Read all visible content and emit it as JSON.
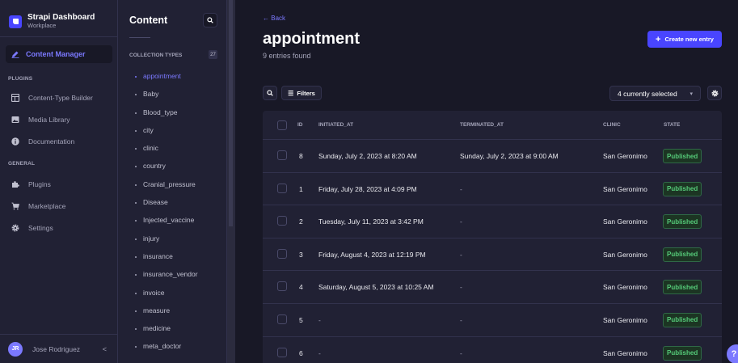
{
  "app": {
    "brand_title": "Strapi Dashboard",
    "brand_subtitle": "Workplace"
  },
  "mainnav": {
    "active_item": "Content Manager",
    "plugins_heading": "PLUGINS",
    "plugins": [
      "Content-Type Builder",
      "Media Library",
      "Documentation"
    ],
    "general_heading": "GENERAL",
    "general": [
      "Plugins",
      "Marketplace",
      "Settings"
    ],
    "user_initials": "JR",
    "user_name": "Jose Rodriguez",
    "collapse_glyph": "<"
  },
  "subnav": {
    "title": "Content",
    "collection_heading": "COLLECTION TYPES",
    "collection_count": "27",
    "items": [
      "appointment",
      "Baby",
      "Blood_type",
      "city",
      "clinic",
      "country",
      "Cranial_pressure",
      "Disease",
      "Injected_vaccine",
      "injury",
      "insurance",
      "insurance_vendor",
      "invoice",
      "measure",
      "medicine",
      "meta_doctor"
    ],
    "active_index": 0
  },
  "main": {
    "back_label": "Back",
    "title": "appointment",
    "subtitle": "9 entries found",
    "create_label": "Create new entry",
    "filters_label": "Filters",
    "columns_select": "4 currently selected"
  },
  "table": {
    "headers": [
      "ID",
      "INITIATED_AT",
      "TERMINATED_AT",
      "CLINIC",
      "STATE"
    ],
    "rows": [
      {
        "id": "8",
        "initiated": "Sunday, July 2, 2023 at 8:20 AM",
        "terminated": "Sunday, July 2, 2023 at 9:00 AM",
        "clinic": "San Geronimo",
        "state": "Published"
      },
      {
        "id": "1",
        "initiated": "Friday, July 28, 2023 at 4:09 PM",
        "terminated": "-",
        "clinic": "San Geronimo",
        "state": "Published"
      },
      {
        "id": "2",
        "initiated": "Tuesday, July 11, 2023 at 3:42 PM",
        "terminated": "-",
        "clinic": "San Geronimo",
        "state": "Published"
      },
      {
        "id": "3",
        "initiated": "Friday, August 4, 2023 at 12:19 PM",
        "terminated": "-",
        "clinic": "San Geronimo",
        "state": "Published"
      },
      {
        "id": "4",
        "initiated": "Saturday, August 5, 2023 at 10:25 AM",
        "terminated": "-",
        "clinic": "San Geronimo",
        "state": "Published"
      },
      {
        "id": "5",
        "initiated": "-",
        "terminated": "-",
        "clinic": "San Geronimo",
        "state": "Published"
      },
      {
        "id": "6",
        "initiated": "-",
        "terminated": "-",
        "clinic": "San Geronimo",
        "state": "Published"
      }
    ]
  },
  "colors": {
    "accent": "#4945ff",
    "accent_light": "#7b79ff",
    "published": "#55cb79"
  }
}
